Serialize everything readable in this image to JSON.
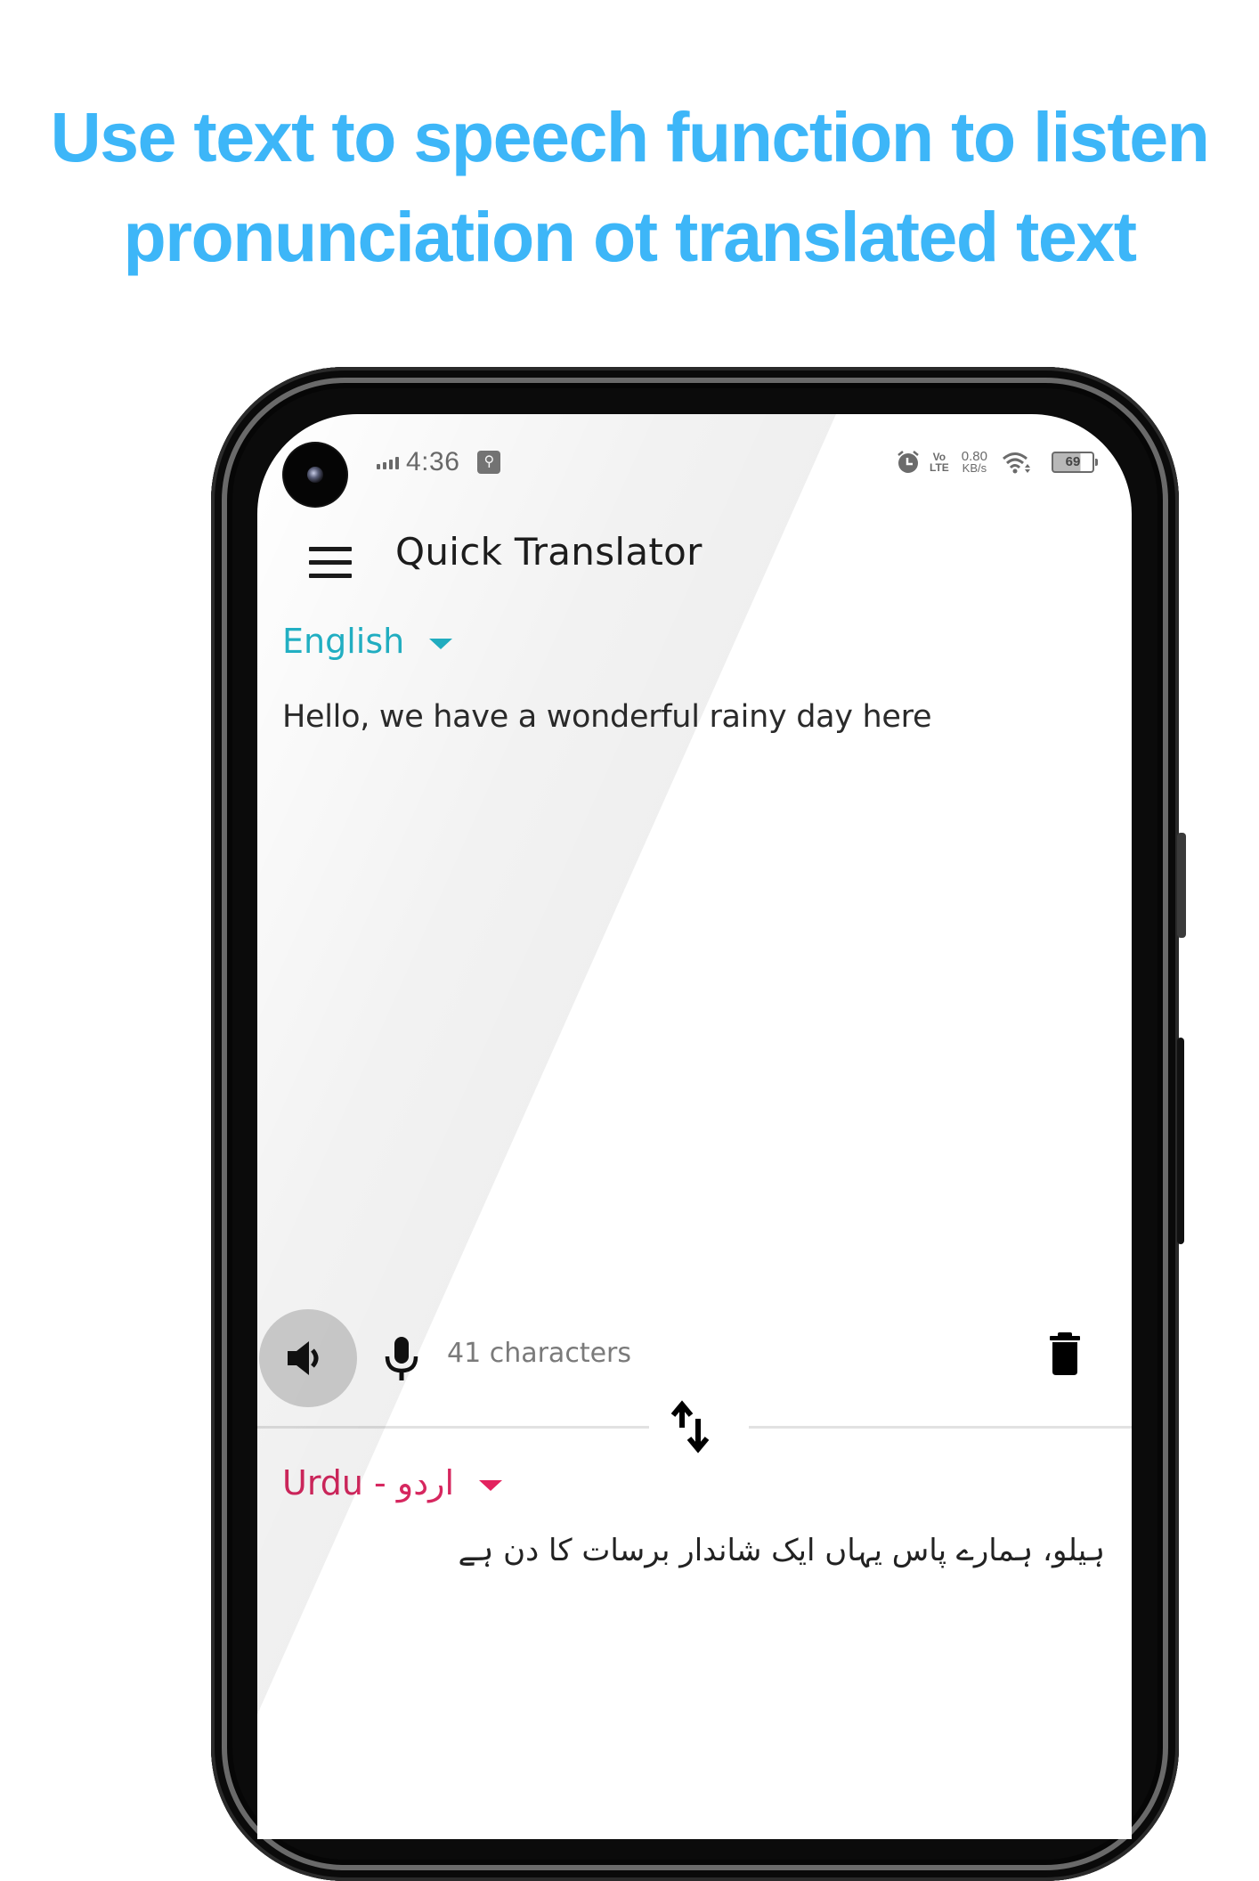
{
  "headline": {
    "line1": "Use text to speech function to listen",
    "line2": "pronunciation ot translated text"
  },
  "status_bar": {
    "time": "4:36",
    "usb_icon": "usb-debug-icon",
    "volte_top": "Vo",
    "volte_bottom": "LTE",
    "net_speed_value": "0.80",
    "net_speed_unit": "KB/s",
    "battery_level": "69"
  },
  "app_bar": {
    "title": "Quick Translator",
    "menu_icon": "hamburger-menu-icon"
  },
  "source": {
    "language": "English",
    "text": "Hello, we have a wonderful rainy day here",
    "char_count": "41 characters",
    "accent_color": "#22b2c6"
  },
  "controls": {
    "speak_icon": "speaker-icon",
    "mic_icon": "microphone-icon",
    "delete_icon": "trash-icon",
    "swap_icon": "swap-vertical-icon"
  },
  "target": {
    "language": "Urdu - اردو",
    "text": "ہیلو، ہمارے پاس یہاں ایک شاندار برسات کا دن ہے",
    "accent_color": "#d6275f"
  },
  "colors": {
    "headline": "#3db6f8"
  }
}
